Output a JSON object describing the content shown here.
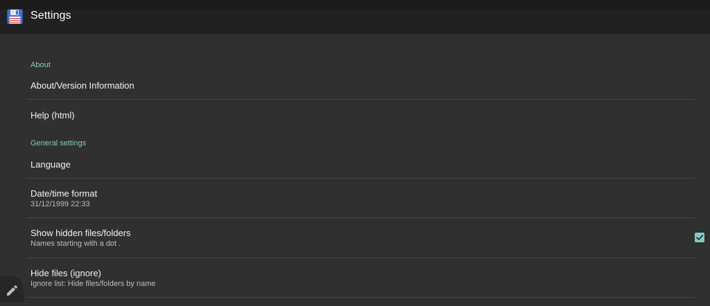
{
  "app_bar": {
    "title": "Settings",
    "icon": "floppy-disk-icon"
  },
  "sections": {
    "about": {
      "header": "About",
      "items": [
        {
          "title": "About/Version Information"
        },
        {
          "title": "Help (html)"
        }
      ]
    },
    "general": {
      "header": "General settings",
      "items": [
        {
          "title": "Language"
        },
        {
          "title": "Date/time format",
          "summary": "31/12/1999  22:33"
        },
        {
          "title": "Show hidden files/folders",
          "summary": "Names starting with a dot .",
          "checked": true
        },
        {
          "title": "Hide files (ignore)",
          "summary": "Ignore list: Hide files/folders by name"
        }
      ]
    }
  },
  "edit_button": {
    "icon": "pencil-icon"
  },
  "colors": {
    "accent": "#80cbc4",
    "category_text": "#7ecfc2",
    "background": "#303030",
    "app_bar": "#212121"
  }
}
